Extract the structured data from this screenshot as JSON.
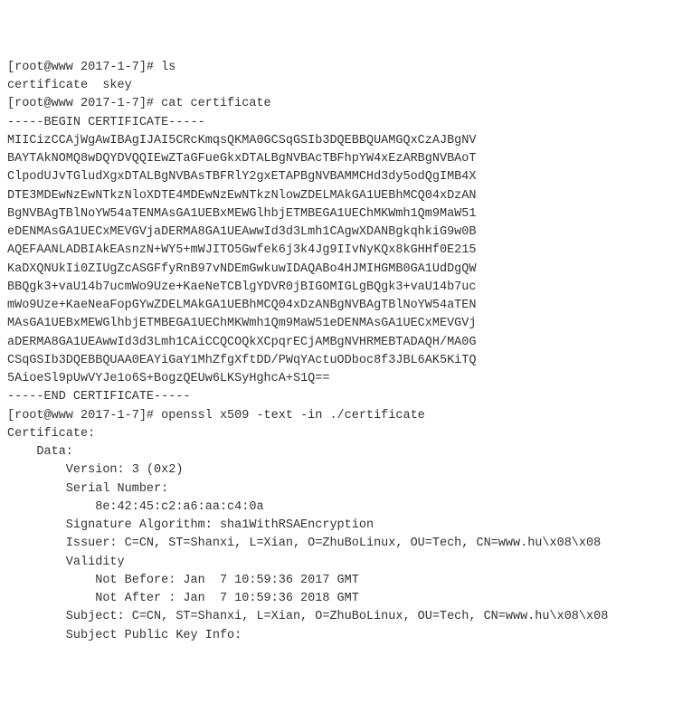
{
  "lines": [
    "[root@www 2017-1-7]# ls",
    "certificate  skey",
    "[root@www 2017-1-7]# cat certificate",
    "-----BEGIN CERTIFICATE-----",
    "MIICizCCAjWgAwIBAgIJAI5CRcKmqsQKMA0GCSqGSIb3DQEBBQUAMGQxCzAJBgNV",
    "BAYTAkNOMQ8wDQYDVQQIEwZTaGFueGkxDTALBgNVBAcTBFhpYW4xEzARBgNVBAoT",
    "ClpodUJvTGludXgxDTALBgNVBAsTBFRlY2gxETAPBgNVBAMMCHd3dy5odQgIMB4X",
    "DTE3MDEwNzEwNTkzNloXDTE4MDEwNzEwNTkzNlowZDELMAkGA1UEBhMCQ04xDzAN",
    "BgNVBAgTBlNoYW54aTENMAsGA1UEBxMEWGlhbjETMBEGA1UEChMKWmh1Qm9MaW51",
    "eDENMAsGA1UECxMEVGVjaDERMA8GA1UEAwwId3d3Lmh1CAgwXDANBgkqhkiG9w0B",
    "AQEFAANLADBIAkEAsnzN+WY5+mWJITO5Gwfek6j3k4Jg9IIvNyKQx8kGHHf0E215",
    "KaDXQNUkIi0ZIUgZcASGFfyRnB97vNDEmGwkuwIDAQABo4HJMIHGMB0GA1UdDgQW",
    "BBQgk3+vaU14b7ucmWo9Uze+KaeNeTCBlgYDVR0jBIGOMIGLgBQgk3+vaU14b7uc",
    "mWo9Uze+KaeNeaFopGYwZDELMAkGA1UEBhMCQ04xDzANBgNVBAgTBlNoYW54aTEN",
    "MAsGA1UEBxMEWGlhbjETMBEGA1UEChMKWmh1Qm9MaW51eDENMAsGA1UECxMEVGVj",
    "aDERMA8GA1UEAwwId3d3Lmh1CAiCCQCOQkXCpqrECjAMBgNVHRMEBTADAQH/MA0G",
    "CSqGSIb3DQEBBQUAA0EAYiGaY1MhZfgXftDD/PWqYActuODboc8f3JBL6AK5KiTQ",
    "5AioeSl9pUwVYJe1o6S+BogzQEUw6LKSyHghcA+S1Q==",
    "-----END CERTIFICATE-----",
    "[root@www 2017-1-7]# openssl x509 -text -in ./certificate",
    "Certificate:",
    "    Data:",
    "        Version: 3 (0x2)",
    "        Serial Number:",
    "            8e:42:45:c2:a6:aa:c4:0a",
    "        Signature Algorithm: sha1WithRSAEncryption",
    "        Issuer: C=CN, ST=Shanxi, L=Xian, O=ZhuBoLinux, OU=Tech, CN=www.hu\\x08\\x08",
    "        Validity",
    "            Not Before: Jan  7 10:59:36 2017 GMT",
    "            Not After : Jan  7 10:59:36 2018 GMT",
    "        Subject: C=CN, ST=Shanxi, L=Xian, O=ZhuBoLinux, OU=Tech, CN=www.hu\\x08\\x08",
    "        Subject Public Key Info:"
  ]
}
